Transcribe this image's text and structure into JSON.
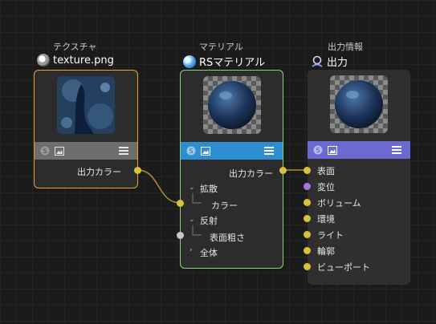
{
  "nodes": {
    "texture": {
      "category": "テクスチャ",
      "title": "texture.png",
      "icon": "texture-node-icon",
      "output_label": "出力カラー",
      "bar_color": "#6e6e6e",
      "border_color": "#e8a33a"
    },
    "material": {
      "category": "マテリアル",
      "title": "RSマテリアル",
      "icon": "material-sphere-icon",
      "output_label": "出力カラー",
      "bar_color": "#2e8fd0",
      "border_color": "#8fcf7a",
      "groups": [
        {
          "label": "拡散",
          "expanded": true,
          "child": "カラー"
        },
        {
          "label": "反射",
          "expanded": true,
          "child": "表面粗さ"
        },
        {
          "label": "全体",
          "expanded": false
        }
      ]
    },
    "output": {
      "category": "出力情報",
      "title": "出力",
      "icon": "output-node-icon",
      "bar_color": "#6a6ad0",
      "inputs": [
        {
          "label": "表面",
          "color": "#d8c23c"
        },
        {
          "label": "変位",
          "color": "#a675e0"
        },
        {
          "label": "ボリューム",
          "color": "#d8c23c"
        },
        {
          "label": "環境",
          "color": "#d8c23c"
        },
        {
          "label": "ライト",
          "color": "#d8c23c"
        },
        {
          "label": "輪郭",
          "color": "#d8c23c"
        },
        {
          "label": "ビューポート",
          "color": "#d8c23c"
        }
      ]
    }
  },
  "colors": {
    "port_yellow": "#d8c23c",
    "port_gray": "#c8c8c8",
    "wire": "#c9a93a"
  }
}
